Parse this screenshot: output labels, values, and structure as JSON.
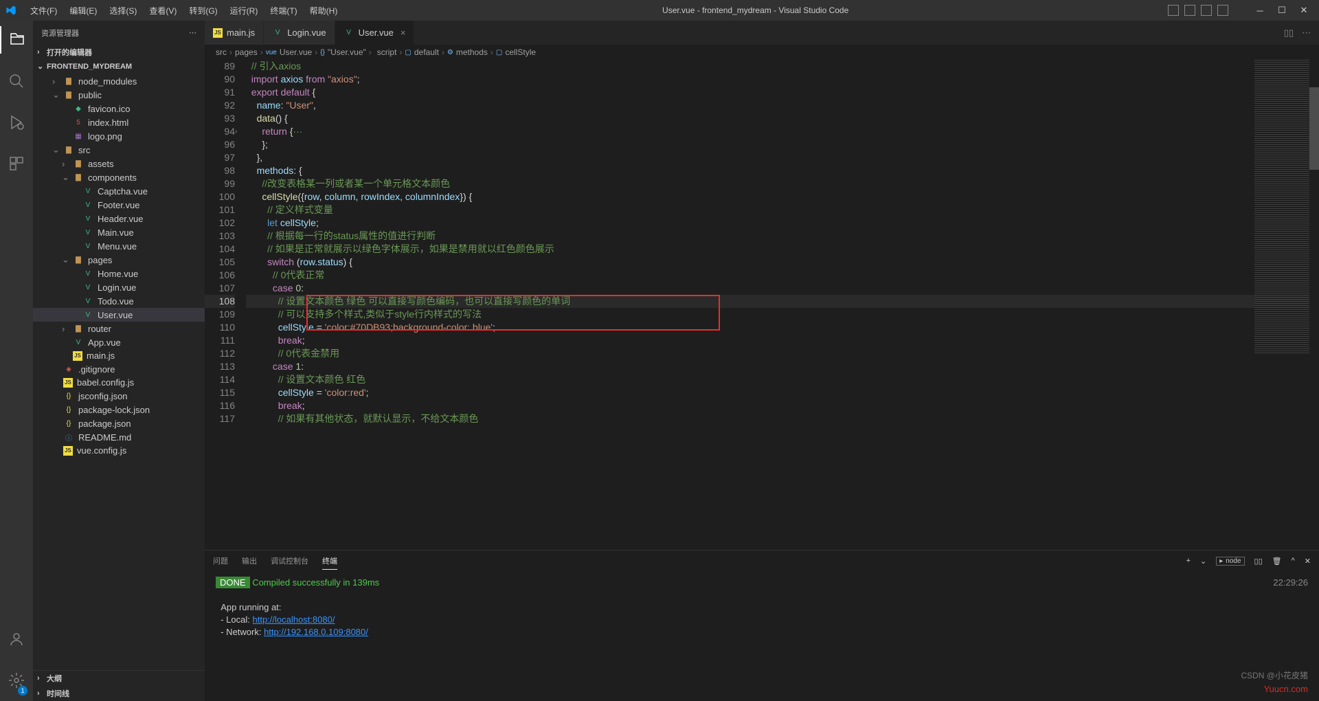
{
  "menu": [
    "文件(F)",
    "编辑(E)",
    "选择(S)",
    "查看(V)",
    "转到(G)",
    "运行(R)",
    "终端(T)",
    "帮助(H)"
  ],
  "title": "User.vue - frontend_mydream - Visual Studio Code",
  "sidebar": {
    "header": "资源管理器",
    "sections": {
      "openEditors": "打开的编辑器",
      "project": "FRONTEND_MYDREAM",
      "outline": "大纲",
      "timeline": "时间线"
    },
    "tree": [
      {
        "label": "node_modules",
        "type": "folder",
        "indent": 1,
        "chev": "›"
      },
      {
        "label": "public",
        "type": "folder-open",
        "indent": 1,
        "chev": "⌄"
      },
      {
        "label": "favicon.ico",
        "type": "ico",
        "indent": 2
      },
      {
        "label": "index.html",
        "type": "html",
        "indent": 2
      },
      {
        "label": "logo.png",
        "type": "img",
        "indent": 2
      },
      {
        "label": "src",
        "type": "folder-open",
        "indent": 1,
        "chev": "⌄"
      },
      {
        "label": "assets",
        "type": "folder",
        "indent": 2,
        "chev": "›"
      },
      {
        "label": "components",
        "type": "folder-open",
        "indent": 2,
        "chev": "⌄"
      },
      {
        "label": "Captcha.vue",
        "type": "vue",
        "indent": 3
      },
      {
        "label": "Footer.vue",
        "type": "vue",
        "indent": 3
      },
      {
        "label": "Header.vue",
        "type": "vue",
        "indent": 3
      },
      {
        "label": "Main.vue",
        "type": "vue",
        "indent": 3
      },
      {
        "label": "Menu.vue",
        "type": "vue",
        "indent": 3
      },
      {
        "label": "pages",
        "type": "folder-open",
        "indent": 2,
        "chev": "⌄"
      },
      {
        "label": "Home.vue",
        "type": "vue",
        "indent": 3
      },
      {
        "label": "Login.vue",
        "type": "vue",
        "indent": 3
      },
      {
        "label": "Todo.vue",
        "type": "vue",
        "indent": 3
      },
      {
        "label": "User.vue",
        "type": "vue",
        "indent": 3,
        "selected": true
      },
      {
        "label": "router",
        "type": "folder",
        "indent": 2,
        "chev": "›"
      },
      {
        "label": "App.vue",
        "type": "vue",
        "indent": 2
      },
      {
        "label": "main.js",
        "type": "js",
        "indent": 2
      },
      {
        "label": ".gitignore",
        "type": "git",
        "indent": 1
      },
      {
        "label": "babel.config.js",
        "type": "js",
        "indent": 1
      },
      {
        "label": "jsconfig.json",
        "type": "json",
        "indent": 1
      },
      {
        "label": "package-lock.json",
        "type": "json",
        "indent": 1
      },
      {
        "label": "package.json",
        "type": "json",
        "indent": 1
      },
      {
        "label": "README.md",
        "type": "md",
        "indent": 1
      },
      {
        "label": "vue.config.js",
        "type": "js",
        "indent": 1
      }
    ]
  },
  "tabs": [
    {
      "label": "main.js",
      "icon": "js"
    },
    {
      "label": "Login.vue",
      "icon": "vue"
    },
    {
      "label": "User.vue",
      "icon": "vue",
      "active": true
    }
  ],
  "breadcrumb": [
    "src",
    "pages",
    "User.vue",
    "\"User.vue\"",
    "script",
    "default",
    "methods",
    "cellStyle"
  ],
  "code": {
    "startLine": 89,
    "currentLine": 108,
    "lines": [
      {
        "n": 89,
        "html": "  <span class='tok-comment'>// 引入axios</span>"
      },
      {
        "n": 90,
        "html": "  <span class='tok-keyword'>import</span> <span class='tok-var'>axios</span> <span class='tok-keyword'>from</span> <span class='tok-string'>\"axios\"</span><span class='tok-punc'>;</span>"
      },
      {
        "n": 91,
        "html": "  <span class='tok-keyword'>export</span> <span class='tok-keyword'>default</span> <span class='tok-punc'>{</span>"
      },
      {
        "n": 92,
        "html": "    <span class='tok-var'>name</span><span class='tok-punc'>:</span> <span class='tok-string'>\"User\"</span><span class='tok-punc'>,</span>"
      },
      {
        "n": 93,
        "html": "    <span class='tok-func'>data</span><span class='tok-punc'>() {</span>"
      },
      {
        "n": 94,
        "html": "      <span class='tok-keyword'>return</span> <span class='tok-punc'>{</span><span class='tok-comment'>···</span>"
      },
      {
        "n": 96,
        "html": "      <span class='tok-punc'>};</span>"
      },
      {
        "n": 97,
        "html": "    <span class='tok-punc'>},</span>"
      },
      {
        "n": 98,
        "html": "    <span class='tok-var'>methods</span><span class='tok-punc'>: {</span>"
      },
      {
        "n": 99,
        "html": "      <span class='tok-comment'>//改变表格某一列或者某一个单元格文本颜色</span>"
      },
      {
        "n": 100,
        "html": "      <span class='tok-func'>cellStyle</span><span class='tok-punc'>({</span><span class='tok-var'>row</span><span class='tok-punc'>,</span> <span class='tok-var'>column</span><span class='tok-punc'>,</span> <span class='tok-var'>rowIndex</span><span class='tok-punc'>,</span> <span class='tok-var'>columnIndex</span><span class='tok-punc'>}) {</span>"
      },
      {
        "n": 101,
        "html": "        <span class='tok-comment'>// 定义样式变量</span>"
      },
      {
        "n": 102,
        "html": "        <span class='tok-type'>let</span> <span class='tok-var'>cellStyle</span><span class='tok-punc'>;</span>"
      },
      {
        "n": 103,
        "html": "        <span class='tok-comment'>// 根据每一行的status属性的值进行判断</span>"
      },
      {
        "n": 104,
        "html": "        <span class='tok-comment'>// 如果是正常就展示以绿色字体展示，如果是禁用就以红色颜色展示</span>"
      },
      {
        "n": 105,
        "html": "        <span class='tok-keyword'>switch</span> <span class='tok-punc'>(</span><span class='tok-var'>row</span><span class='tok-punc'>.</span><span class='tok-var'>status</span><span class='tok-punc'>) {</span>"
      },
      {
        "n": 106,
        "html": "          <span class='tok-comment'>// 0代表正常</span>"
      },
      {
        "n": 107,
        "html": "          <span class='tok-keyword'>case</span> <span class='tok-num'>0</span><span class='tok-punc'>:</span>"
      },
      {
        "n": 108,
        "html": "            <span class='tok-comment'>// 设置文本颜色 绿色 可以直接写颜色编码，也可以直接写颜色的单词</span>"
      },
      {
        "n": 109,
        "html": "            <span class='tok-comment'>// 可以支持多个样式,类似于style行内样式的写法</span>"
      },
      {
        "n": 110,
        "html": "            <span class='tok-var'>cellStyle</span> <span class='tok-punc'>=</span> <span class='tok-string'>'color:#70DB93;background-color: blue'</span><span class='tok-punc'>;</span>"
      },
      {
        "n": 111,
        "html": "            <span class='tok-keyword'>break</span><span class='tok-punc'>;</span>"
      },
      {
        "n": 112,
        "html": "            <span class='tok-comment'>// 0代表金禁用</span>"
      },
      {
        "n": 113,
        "html": "          <span class='tok-keyword'>case</span> <span class='tok-num'>1</span><span class='tok-punc'>:</span>"
      },
      {
        "n": 114,
        "html": "            <span class='tok-comment'>// 设置文本颜色 红色</span>"
      },
      {
        "n": 115,
        "html": "            <span class='tok-var'>cellStyle</span> <span class='tok-punc'>=</span> <span class='tok-string'>'color:red'</span><span class='tok-punc'>;</span>"
      },
      {
        "n": 116,
        "html": "            <span class='tok-keyword'>break</span><span class='tok-punc'>;</span>"
      },
      {
        "n": 117,
        "html": "            <span class='tok-comment'>// 如果有其他状态，就默认显示，不给文本颜色</span>"
      }
    ]
  },
  "panel": {
    "tabs": [
      "问题",
      "输出",
      "调试控制台",
      "终端"
    ],
    "activeTab": 3,
    "nodeLabel": "node",
    "done": "DONE",
    "compiled": "Compiled successfully in 139ms",
    "running": "App running at:",
    "local": "- Local:   ",
    "localUrl": "http://localhost:8080/",
    "network": "- Network: ",
    "networkUrl": "http://192.168.0.109:8080/",
    "time": "22:29:26"
  },
  "watermark": "Yuucn.com",
  "watermark2": "CSDN @小花皮猪"
}
